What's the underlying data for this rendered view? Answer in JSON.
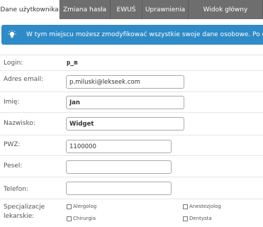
{
  "tabs": [
    {
      "label": "Dane użytkownika"
    },
    {
      "label": "Zmiana hasła"
    },
    {
      "label": "EWUŚ"
    },
    {
      "label": "Uprawnienia"
    },
    {
      "label": "Widok główny"
    }
  ],
  "alert": {
    "text": "W tym miejscu możesz zmodyfikować wszystkie swoje dane osobowe. Po dokon",
    "icon": "lightbulb-icon",
    "color": "#2e8bc8"
  },
  "form": {
    "login_label": "Login:",
    "login_value": "p_m",
    "email_label": "Adres email:",
    "email_value": "p.miluski@lekseek.com",
    "first_name_label": "Imię:",
    "first_name_value": "Jan",
    "last_name_label": "Nazwisko:",
    "last_name_value": "Widget",
    "pwz_label": "PWZ:",
    "pwz_value": "1100000",
    "pesel_label": "Pesel:",
    "pesel_value": "",
    "phone_label": "Telefon:",
    "phone_value": "",
    "spec_label_1": "Specjalizacje",
    "spec_label_2": "lekarskie:",
    "specializations": [
      "Alergolog",
      "Anestezjolog",
      "Chirurgia",
      "Dentysta"
    ]
  }
}
